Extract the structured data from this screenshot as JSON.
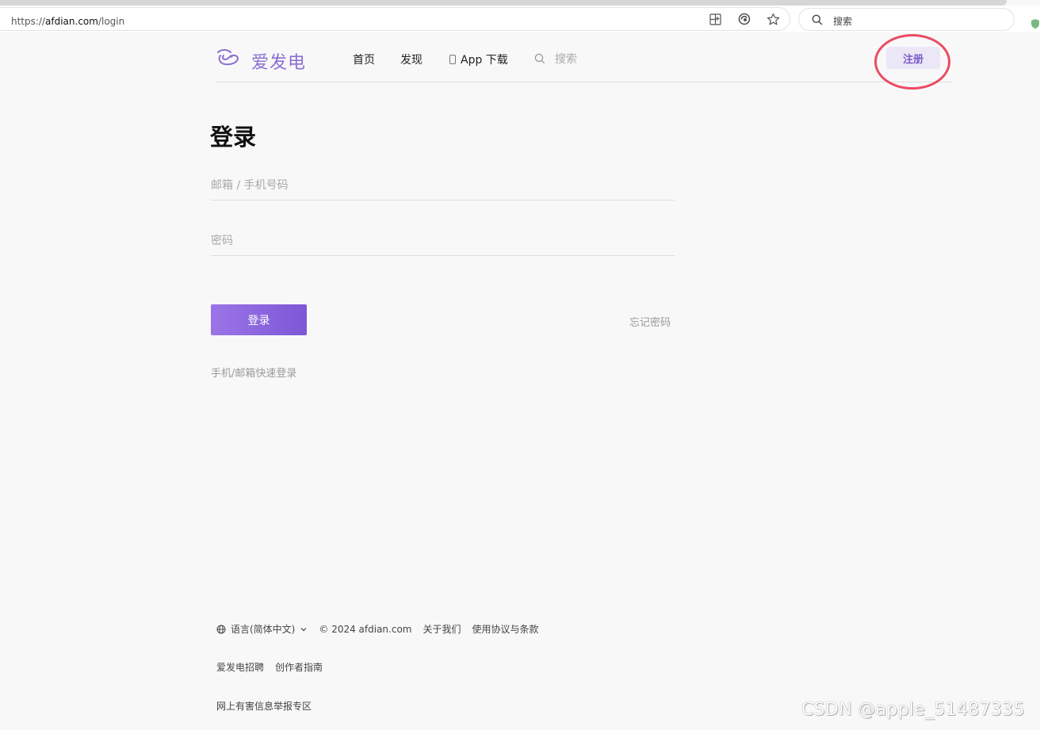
{
  "browser": {
    "url_prefix": "https://",
    "url_host": "afdian.com",
    "url_path": "/login",
    "search_placeholder": "搜索"
  },
  "header": {
    "logo_text": "爱发电",
    "nav": {
      "home": "首页",
      "discover": "发现",
      "app_download": "App 下载"
    },
    "search_placeholder": "搜索",
    "register_label": "注册"
  },
  "login": {
    "title": "登录",
    "email_placeholder": "邮箱 / 手机号码",
    "password_placeholder": "密码",
    "submit_label": "登录",
    "forgot_password": "忘记密码",
    "quick_login": "手机/邮箱快速登录"
  },
  "footer": {
    "language": "语言(简体中文)",
    "copyright": "© 2024 afdian.com",
    "about": "关于我们",
    "terms": "使用协议与条款",
    "jobs": "爱发电招聘",
    "creator_guide": "创作者指南",
    "report": "网上有害信息举报专区"
  },
  "watermark": "CSDN @apple_51487335",
  "colors": {
    "brand": "#8b6ed0",
    "button_gradient_start": "#9b75e6",
    "button_gradient_end": "#7d57d6",
    "annotation_ring": "#ea4c62",
    "page_bg": "#f8f8f9"
  }
}
